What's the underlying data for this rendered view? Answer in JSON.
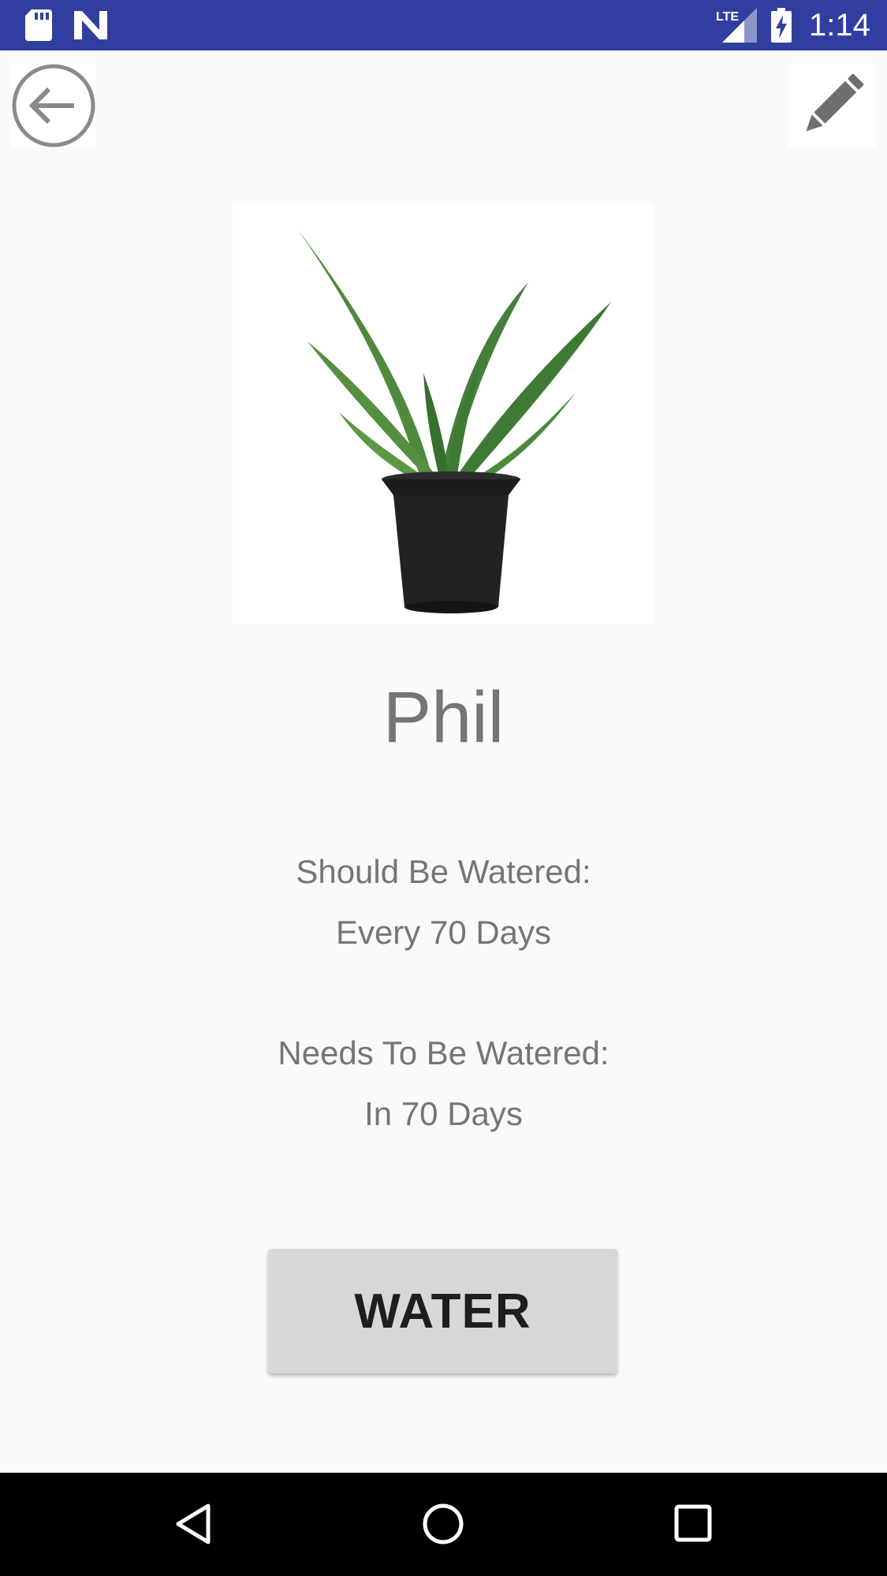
{
  "status_bar": {
    "time": "1:14",
    "network": "LTE",
    "icons": [
      "sd-card-icon",
      "n-notification-icon",
      "lte-signal-icon",
      "battery-charging-icon"
    ]
  },
  "toolbar": {
    "back_icon": "arrow-back-circle-icon",
    "edit_icon": "pencil-icon"
  },
  "plant": {
    "name": "Phil",
    "image": "aloe-plant-in-black-pot"
  },
  "schedule": {
    "should_label": "Should Be Watered:",
    "should_value": "Every 70 Days",
    "needs_label": "Needs To Be Watered:",
    "needs_value": "In 70 Days"
  },
  "actions": {
    "water_label": "WATER"
  },
  "nav_bar": {
    "icons": [
      "back-triangle-icon",
      "home-circle-icon",
      "recents-square-icon"
    ]
  },
  "colors": {
    "status_bar": "#303f9f",
    "background": "#fafafa",
    "text_gray": "#757575",
    "button_gray": "#d6d7d7",
    "nav_bar": "#000000"
  }
}
